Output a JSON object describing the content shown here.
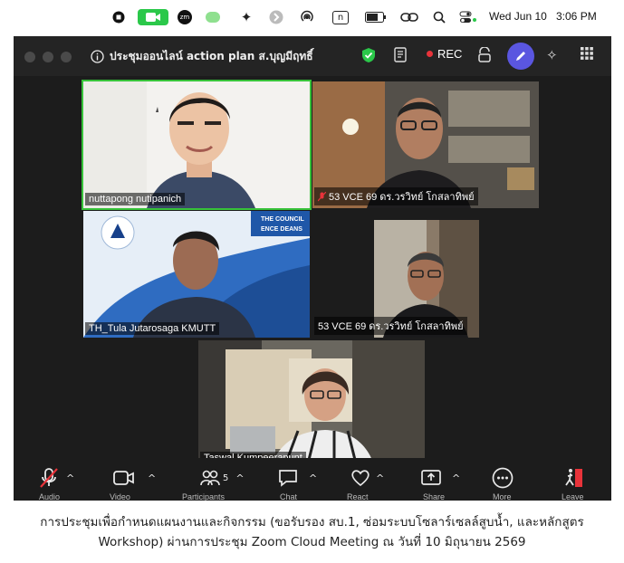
{
  "menubar": {
    "date": "Wed Jun 10",
    "time": "3:06 PM",
    "items": [
      "record-stop-icon",
      "zoom-video-icon",
      "zm-icon",
      "chat-bubble-icon",
      "sparkle-icon",
      "arrow-circle-icon",
      "airdrop-icon",
      "n-icon",
      "battery-icon",
      "link-icon",
      "search-icon",
      "control-center-icon"
    ],
    "zm_label": "zm",
    "n_label": "n",
    "accent_green": "#2bc84a"
  },
  "window": {
    "title": "ประชุมออนไลน์ action plan ส.บุญมีฤทธิ์",
    "rec_label": "REC"
  },
  "participants": [
    {
      "name": "nuttapong nutipanich",
      "active": true
    },
    {
      "name": "53 VCE 69  ดร.วรวิทย์ โกสลาทิพย์",
      "muted": true
    },
    {
      "name": "TH_Tula Jutarosaga KMUTT",
      "bg_text": "THE COUNCIL\nENCE DEANS"
    },
    {
      "name": "53 VCE 69  ดร.วรวิทย์ โกสลาทิพย์"
    },
    {
      "name": "Taswal Kumpeerapunt"
    }
  ],
  "toolbar": {
    "audio": "Audio",
    "video": "Video",
    "participants": "Participants",
    "participants_count": "5",
    "chat": "Chat",
    "react": "React",
    "share": "Share",
    "more": "More",
    "leave": "Leave"
  },
  "caption": {
    "line1": "การประชุมเพื่อกำหนดแผนงานและกิจกรรม (ขอรับรอง สบ.1, ซ่อมระบบโซลาร์เซลล์สูบน้ำ, และหลักสูตร",
    "line2": "Workshop) ผ่านการประชุม Zoom Cloud Meeting ณ วันที่ 10 มิถุนายน 2569"
  }
}
